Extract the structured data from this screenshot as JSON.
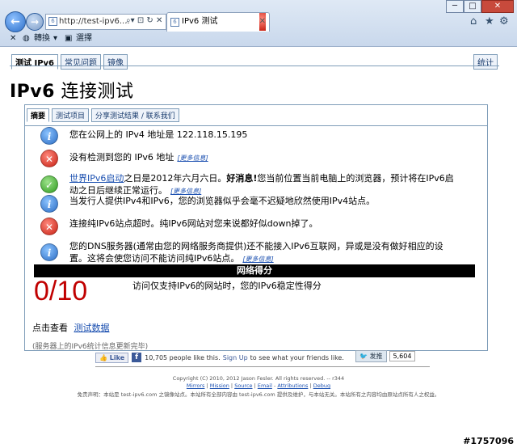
{
  "browser": {
    "url": "http://test-ipv6....",
    "tab_title": "IPv6 测试",
    "menu_convert": "轉換",
    "menu_select": "選擇"
  },
  "top_tabs": [
    "测试 IPv6",
    "常见问题",
    "镜像"
  ],
  "stats_label": "统计",
  "page_title_main": "IPv6",
  "page_title_rest": " 连接测试",
  "sub_tabs": [
    "摘要",
    "测试项目",
    "分享测试结果 / 联系我们"
  ],
  "results": [
    {
      "icon": "info",
      "text": "您在公网上的 IPv4 地址是 122.118.15.195",
      "more": ""
    },
    {
      "icon": "error",
      "text": "没有检测到您的 IPv6 地址",
      "more": "[更多信息]"
    },
    {
      "icon": "ok",
      "link": "世界IPv6启动",
      "text": "之日是2012年六月六日。",
      "bold": "好消息!",
      "text2": "您当前位置当前电脑上的浏览器，预计将在IPv6启动之日后继续正常运行。",
      "more": "[更多信息]"
    },
    {
      "icon": "info",
      "text": "当发行人提供IPv4和IPv6，您的浏览器似乎会毫不迟疑地欣然使用IPv4站点。",
      "more": ""
    },
    {
      "icon": "error",
      "text": "连接纯IPv6站点超时。纯IPv6网站对您来说都好似down掉了。",
      "more": ""
    },
    {
      "icon": "info",
      "text": "您的DNS服务器(通常由您的网络服务商提供)还不能接入IPv6互联网，异或是没有做好相应的设置。这将会使您访问不能访问纯IPv6站点。",
      "more": "[更多信息]"
    }
  ],
  "score_header": "网络得分",
  "score": "0/10",
  "score_desc": "访问仅支持IPv6的网站时，您的IPv6稳定性得分",
  "check_label": "点击查看",
  "check_link": "测试数据",
  "server_note": "(服务器上的IPv6统计信息更新完毕)",
  "social": {
    "like": "Like",
    "like_text": "10,705 people like this.",
    "signup": "Sign Up",
    "signup_text": "to see what your friends like.",
    "tweet": "发推",
    "tweet_count": "5,604"
  },
  "footer": {
    "copyright": "Copyright (C) 2010, 2012 Jason Fesler. All rights reserved. -- r344",
    "links": [
      "Mirrors",
      "Mission",
      "Source",
      "Email",
      "Attributions",
      "Debug"
    ],
    "disclaimer": "免责声明：本站是 test-ipv6.com 之镜像站点。本站所有全部内容由 test-ipv6.com 提供及维护，与本站无关。本站所有之内容均由原站点所有人之权益。"
  },
  "watermark": "#1757096"
}
